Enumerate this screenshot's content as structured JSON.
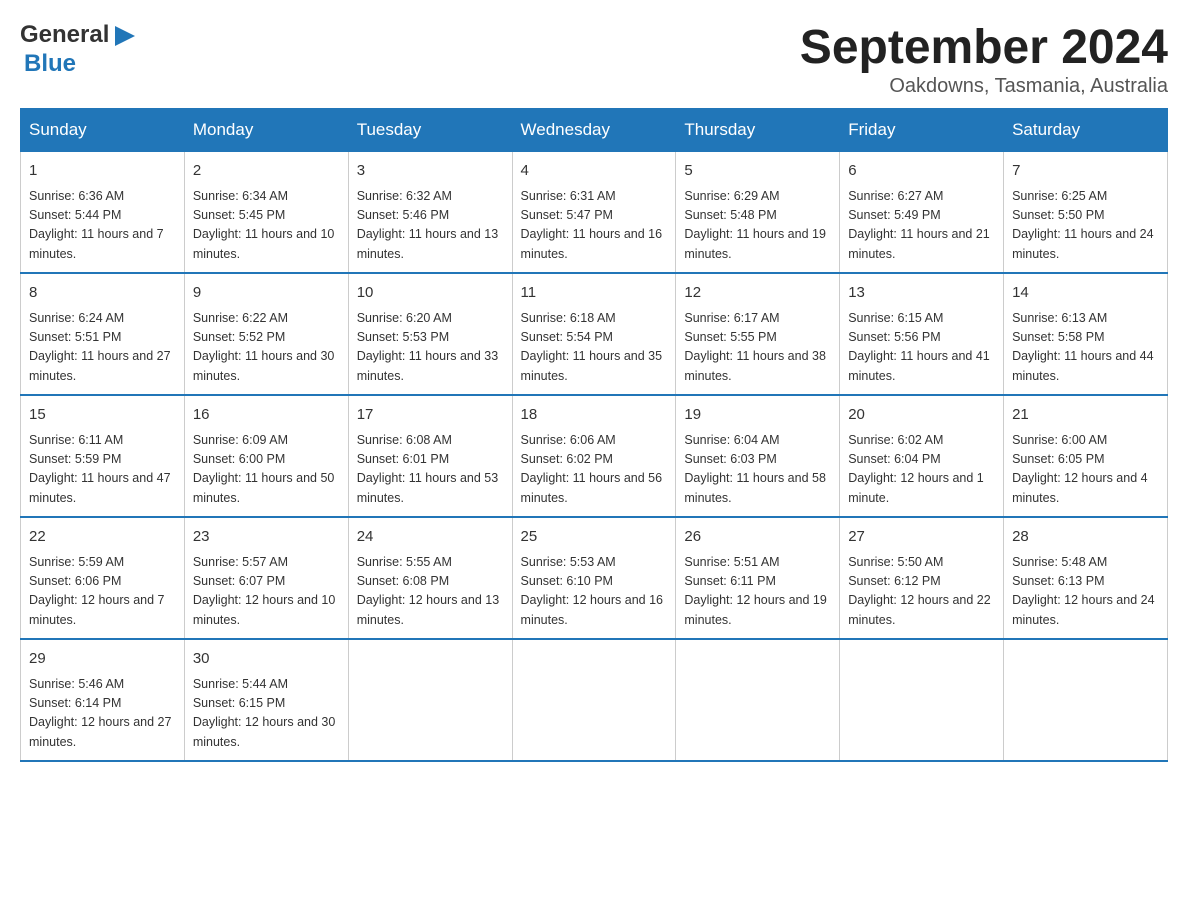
{
  "header": {
    "logo": {
      "general": "General",
      "blue": "Blue"
    },
    "title": "September 2024",
    "location": "Oakdowns, Tasmania, Australia"
  },
  "weekdays": [
    "Sunday",
    "Monday",
    "Tuesday",
    "Wednesday",
    "Thursday",
    "Friday",
    "Saturday"
  ],
  "weeks": [
    [
      {
        "day": "1",
        "sunrise": "6:36 AM",
        "sunset": "5:44 PM",
        "daylight": "11 hours and 7 minutes."
      },
      {
        "day": "2",
        "sunrise": "6:34 AM",
        "sunset": "5:45 PM",
        "daylight": "11 hours and 10 minutes."
      },
      {
        "day": "3",
        "sunrise": "6:32 AM",
        "sunset": "5:46 PM",
        "daylight": "11 hours and 13 minutes."
      },
      {
        "day": "4",
        "sunrise": "6:31 AM",
        "sunset": "5:47 PM",
        "daylight": "11 hours and 16 minutes."
      },
      {
        "day": "5",
        "sunrise": "6:29 AM",
        "sunset": "5:48 PM",
        "daylight": "11 hours and 19 minutes."
      },
      {
        "day": "6",
        "sunrise": "6:27 AM",
        "sunset": "5:49 PM",
        "daylight": "11 hours and 21 minutes."
      },
      {
        "day": "7",
        "sunrise": "6:25 AM",
        "sunset": "5:50 PM",
        "daylight": "11 hours and 24 minutes."
      }
    ],
    [
      {
        "day": "8",
        "sunrise": "6:24 AM",
        "sunset": "5:51 PM",
        "daylight": "11 hours and 27 minutes."
      },
      {
        "day": "9",
        "sunrise": "6:22 AM",
        "sunset": "5:52 PM",
        "daylight": "11 hours and 30 minutes."
      },
      {
        "day": "10",
        "sunrise": "6:20 AM",
        "sunset": "5:53 PM",
        "daylight": "11 hours and 33 minutes."
      },
      {
        "day": "11",
        "sunrise": "6:18 AM",
        "sunset": "5:54 PM",
        "daylight": "11 hours and 35 minutes."
      },
      {
        "day": "12",
        "sunrise": "6:17 AM",
        "sunset": "5:55 PM",
        "daylight": "11 hours and 38 minutes."
      },
      {
        "day": "13",
        "sunrise": "6:15 AM",
        "sunset": "5:56 PM",
        "daylight": "11 hours and 41 minutes."
      },
      {
        "day": "14",
        "sunrise": "6:13 AM",
        "sunset": "5:58 PM",
        "daylight": "11 hours and 44 minutes."
      }
    ],
    [
      {
        "day": "15",
        "sunrise": "6:11 AM",
        "sunset": "5:59 PM",
        "daylight": "11 hours and 47 minutes."
      },
      {
        "day": "16",
        "sunrise": "6:09 AM",
        "sunset": "6:00 PM",
        "daylight": "11 hours and 50 minutes."
      },
      {
        "day": "17",
        "sunrise": "6:08 AM",
        "sunset": "6:01 PM",
        "daylight": "11 hours and 53 minutes."
      },
      {
        "day": "18",
        "sunrise": "6:06 AM",
        "sunset": "6:02 PM",
        "daylight": "11 hours and 56 minutes."
      },
      {
        "day": "19",
        "sunrise": "6:04 AM",
        "sunset": "6:03 PM",
        "daylight": "11 hours and 58 minutes."
      },
      {
        "day": "20",
        "sunrise": "6:02 AM",
        "sunset": "6:04 PM",
        "daylight": "12 hours and 1 minute."
      },
      {
        "day": "21",
        "sunrise": "6:00 AM",
        "sunset": "6:05 PM",
        "daylight": "12 hours and 4 minutes."
      }
    ],
    [
      {
        "day": "22",
        "sunrise": "5:59 AM",
        "sunset": "6:06 PM",
        "daylight": "12 hours and 7 minutes."
      },
      {
        "day": "23",
        "sunrise": "5:57 AM",
        "sunset": "6:07 PM",
        "daylight": "12 hours and 10 minutes."
      },
      {
        "day": "24",
        "sunrise": "5:55 AM",
        "sunset": "6:08 PM",
        "daylight": "12 hours and 13 minutes."
      },
      {
        "day": "25",
        "sunrise": "5:53 AM",
        "sunset": "6:10 PM",
        "daylight": "12 hours and 16 minutes."
      },
      {
        "day": "26",
        "sunrise": "5:51 AM",
        "sunset": "6:11 PM",
        "daylight": "12 hours and 19 minutes."
      },
      {
        "day": "27",
        "sunrise": "5:50 AM",
        "sunset": "6:12 PM",
        "daylight": "12 hours and 22 minutes."
      },
      {
        "day": "28",
        "sunrise": "5:48 AM",
        "sunset": "6:13 PM",
        "daylight": "12 hours and 24 minutes."
      }
    ],
    [
      {
        "day": "29",
        "sunrise": "5:46 AM",
        "sunset": "6:14 PM",
        "daylight": "12 hours and 27 minutes."
      },
      {
        "day": "30",
        "sunrise": "5:44 AM",
        "sunset": "6:15 PM",
        "daylight": "12 hours and 30 minutes."
      },
      null,
      null,
      null,
      null,
      null
    ]
  ]
}
